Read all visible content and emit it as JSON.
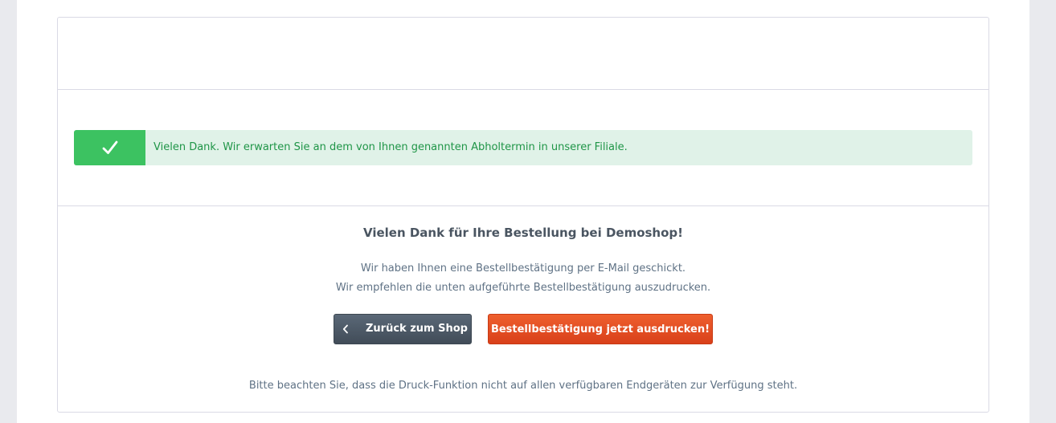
{
  "alert": {
    "icon": "checkmark-icon",
    "text": "Vielen Dank. Wir erwarten Sie an dem von Ihnen genannten Abholtermin in unserer Filiale.",
    "colors": {
      "icon_bg": "#3cc261",
      "bg": "#e0f2e8",
      "text": "#1f9547"
    }
  },
  "finish": {
    "title": "Vielen Dank für Ihre Bestellung bei Demoshop!",
    "line1": "Wir haben Ihnen eine Bestellbestätigung per E-Mail geschickt.",
    "line2": "Wir empfehlen die unten aufgeführte Bestellbestätigung auszudrucken.",
    "back_button": {
      "icon": "chevron-left-icon",
      "label": "Zurück zum Shop"
    },
    "print_button": {
      "label": "Bestellbestätigung jetzt ausdrucken!"
    },
    "note": "Bitte beachten Sie, dass die Druck-Funktion nicht auf allen verfügbaren Endgeräten zur Verfügung steht."
  },
  "colors": {
    "back_button": "#4e5b69",
    "print_button": "#e64d20"
  }
}
